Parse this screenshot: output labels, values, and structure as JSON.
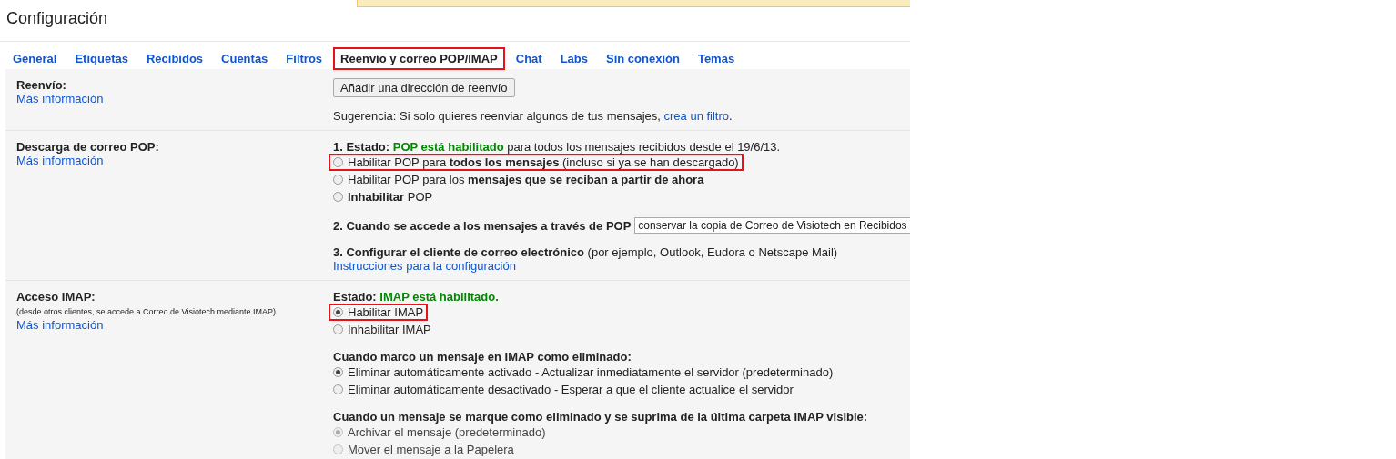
{
  "title": "Configuración",
  "tabs": [
    {
      "label": "General",
      "selected": false,
      "highlighted": false
    },
    {
      "label": "Etiquetas",
      "selected": false,
      "highlighted": false
    },
    {
      "label": "Recibidos",
      "selected": false,
      "highlighted": false
    },
    {
      "label": "Cuentas",
      "selected": false,
      "highlighted": false
    },
    {
      "label": "Filtros",
      "selected": false,
      "highlighted": false
    },
    {
      "label": "Reenvío y correo POP/IMAP",
      "selected": true,
      "highlighted": true
    },
    {
      "label": "Chat",
      "selected": false,
      "highlighted": false
    },
    {
      "label": "Labs",
      "selected": false,
      "highlighted": false
    },
    {
      "label": "Sin conexión",
      "selected": false,
      "highlighted": false
    },
    {
      "label": "Temas",
      "selected": false,
      "highlighted": false
    }
  ],
  "sections": [
    {
      "label": "Reenvío:",
      "link": "Más información",
      "groups": [
        [
          {
            "kind": "button",
            "label": "Añadir una dirección de reenvío"
          }
        ],
        [
          {
            "kind": "hint",
            "text": "Sugerencia: Si solo quieres reenviar algunos de tus mensajes, ",
            "link": "crea un filtro",
            "end": "."
          }
        ]
      ]
    },
    {
      "label": "Descarga de correo POP:",
      "link": "Más información",
      "groups": [
        [
          {
            "kind": "status",
            "prefix": "1. Estado: ",
            "value": "POP está habilitado",
            "suffix": " para todos los mensajes recibidos desde el 19/6/13."
          },
          {
            "kind": "radio",
            "label": "Habilitar POP para **todos los mensajes** (incluso si ya se han descargado)",
            "selected": false,
            "highlighted": true,
            "disabled": false
          },
          {
            "kind": "radio",
            "label": "Habilitar POP para los **mensajes que se reciban a partir de ahora**",
            "selected": false,
            "highlighted": false,
            "disabled": false
          },
          {
            "kind": "radio",
            "label": "**Inhabilitar** POP",
            "selected": false,
            "highlighted": false,
            "disabled": false
          }
        ],
        [
          {
            "kind": "select",
            "label": "2. Cuando se accede a los mensajes a través de POP",
            "value": "conservar la copia de Correo de Visiotech en Recibidos"
          }
        ],
        [
          {
            "kind": "text",
            "text": "**3. Configurar el cliente de correo electrónico** (por ejemplo, Outlook, Eudora o Netscape Mail)"
          },
          {
            "kind": "link",
            "text": "Instrucciones para la configuración"
          }
        ]
      ]
    },
    {
      "label": "Acceso IMAP:",
      "note": "(desde otros clientes, se accede a Correo de Visiotech mediante IMAP)",
      "link": "Más información",
      "groups": [
        [
          {
            "kind": "status",
            "prefix": "Estado: ",
            "value": "IMAP está habilitado."
          },
          {
            "kind": "radio",
            "label": "Habilitar IMAP",
            "selected": true,
            "highlighted": true,
            "disabled": false
          },
          {
            "kind": "radio",
            "label": "Inhabilitar IMAP",
            "selected": false,
            "highlighted": false,
            "disabled": false
          }
        ],
        [
          {
            "kind": "heading",
            "text": "Cuando marco un mensaje en IMAP como eliminado:"
          },
          {
            "kind": "radio",
            "label": "Eliminar automáticamente activado - Actualizar inmediatamente el servidor (predeterminado)",
            "selected": true,
            "highlighted": false,
            "disabled": false
          },
          {
            "kind": "radio",
            "label": "Eliminar automáticamente desactivado - Esperar a que el cliente actualice el servidor",
            "selected": false,
            "highlighted": false,
            "disabled": false
          }
        ],
        [
          {
            "kind": "heading",
            "text": "Cuando un mensaje se marque como eliminado y se suprima de la última carpeta IMAP visible:"
          },
          {
            "kind": "radio",
            "label": "Archivar el mensaje (predeterminado)",
            "selected": true,
            "highlighted": false,
            "disabled": true
          },
          {
            "kind": "radio",
            "label": "Mover el mensaje a la Papelera",
            "selected": false,
            "highlighted": false,
            "disabled": true
          }
        ]
      ]
    }
  ]
}
